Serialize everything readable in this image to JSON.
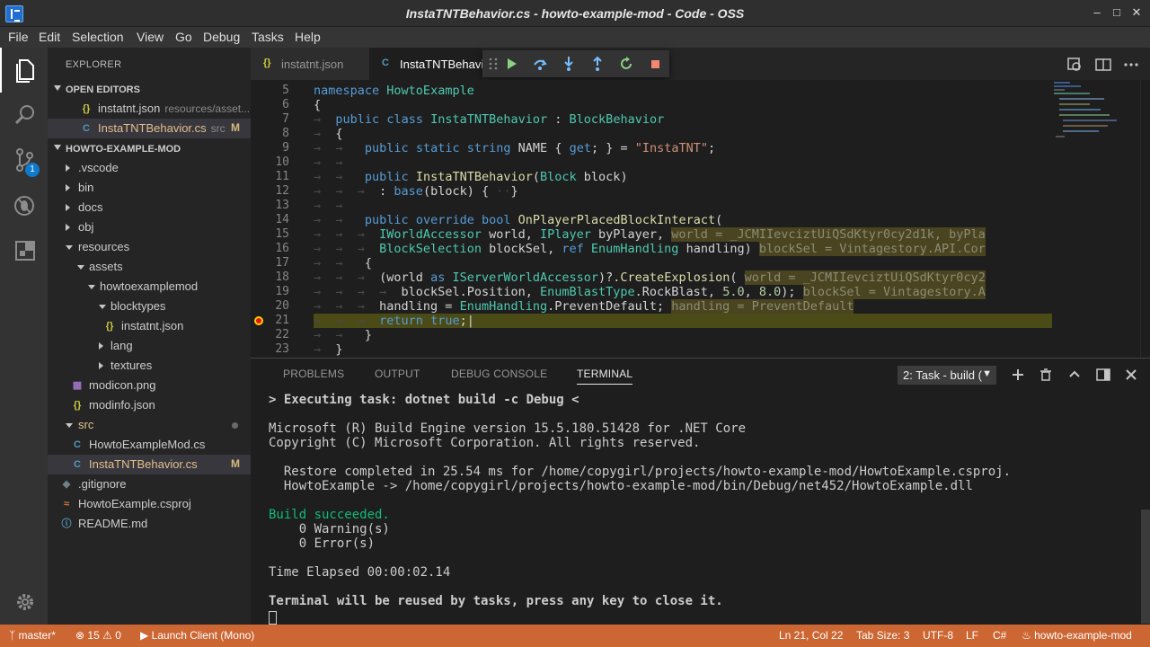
{
  "window": {
    "title": "InstaTNTBehavior.cs - howto-example-mod - Code - OSS"
  },
  "menu": [
    "File",
    "Edit",
    "Selection",
    "View",
    "Go",
    "Debug",
    "Tasks",
    "Help"
  ],
  "activity": {
    "scm_badge": "1"
  },
  "sidebar": {
    "title": "EXPLORER",
    "open_editors_label": "OPEN EDITORS",
    "open_editors": [
      {
        "name": "instatnt.json",
        "desc": "resources/asset...",
        "icon": "json-icon"
      },
      {
        "name": "InstaTNTBehavior.cs",
        "desc": "src",
        "flag": "M",
        "icon": "csharp-icon"
      }
    ],
    "project_label": "HOWTO-EXAMPLE-MOD",
    "tree": [
      {
        "name": ".vscode"
      },
      {
        "name": "bin"
      },
      {
        "name": "docs"
      },
      {
        "name": "obj"
      },
      {
        "name": "resources"
      },
      {
        "name": "assets"
      },
      {
        "name": "howtoexamplemod"
      },
      {
        "name": "blocktypes"
      },
      {
        "name": "instatnt.json"
      },
      {
        "name": "lang"
      },
      {
        "name": "textures"
      },
      {
        "name": "modicon.png"
      },
      {
        "name": "modinfo.json"
      },
      {
        "name": "src"
      },
      {
        "name": "HowtoExampleMod.cs"
      },
      {
        "name": "InstaTNTBehavior.cs",
        "flag": "M"
      },
      {
        "name": ".gitignore"
      },
      {
        "name": "HowtoExample.csproj"
      },
      {
        "name": "README.md"
      }
    ]
  },
  "tabs": [
    {
      "label": "instatnt.json",
      "icon": "json-icon"
    },
    {
      "label": "InstaTNTBehavior.cs",
      "icon": "csharp-icon"
    }
  ],
  "editor": {
    "current_line": 21,
    "lines": [
      {
        "n": "5"
      },
      {
        "n": "6"
      },
      {
        "n": "7"
      },
      {
        "n": "8"
      },
      {
        "n": "9"
      },
      {
        "n": "10"
      },
      {
        "n": "11"
      },
      {
        "n": "12"
      },
      {
        "n": "13"
      },
      {
        "n": "14"
      },
      {
        "n": "15"
      },
      {
        "n": "16"
      },
      {
        "n": "17"
      },
      {
        "n": "18"
      },
      {
        "n": "19"
      },
      {
        "n": "20"
      },
      {
        "n": "21"
      },
      {
        "n": "22"
      },
      {
        "n": "23"
      }
    ],
    "inlay": {
      "l15": "world = _JCMIIevciztUiQSdKtyr0cy2d1k, byPla",
      "l16": "blockSel = Vintagestory.API.Cor",
      "l18": "world = _JCMIIevciztUiQSdKtyr0cy2",
      "l19": "blockSel = Vintagestory.A",
      "l20": "handling = PreventDefault"
    }
  },
  "panel": {
    "tabs": [
      "PROBLEMS",
      "OUTPUT",
      "DEBUG CONSOLE",
      "TERMINAL"
    ],
    "terminal_select": "2: Task - build (",
    "terminal": {
      "l1": "> Executing task: dotnet build -c Debug <",
      "l2": "Microsoft (R) Build Engine version 15.5.180.51428 for .NET Core",
      "l3": "Copyright (C) Microsoft Corporation. All rights reserved.",
      "l4": "  Restore completed in 25.54 ms for /home/copygirl/projects/howto-example-mod/HowtoExample.csproj.",
      "l5": "  HowtoExample -> /home/copygirl/projects/howto-example-mod/bin/Debug/net452/HowtoExample.dll",
      "l6": "Build succeeded.",
      "l7": "    0 Warning(s)",
      "l8": "    0 Error(s)",
      "l9": "Time Elapsed 00:00:02.14",
      "l10": "Terminal will be reused by tasks, press any key to close it."
    }
  },
  "status": {
    "branch": "master*",
    "errors": "15",
    "warnings": "0",
    "launch": "Launch Client (Mono)",
    "position": "Ln 21, Col 22",
    "tab_size": "Tab Size: 3",
    "encoding": "UTF-8",
    "eol": "LF",
    "language": "C#",
    "project": "howto-example-mod"
  },
  "colors": {
    "status_bg": "#cc6633",
    "accent": "#0e7acc",
    "modified": "#e2c08d"
  }
}
